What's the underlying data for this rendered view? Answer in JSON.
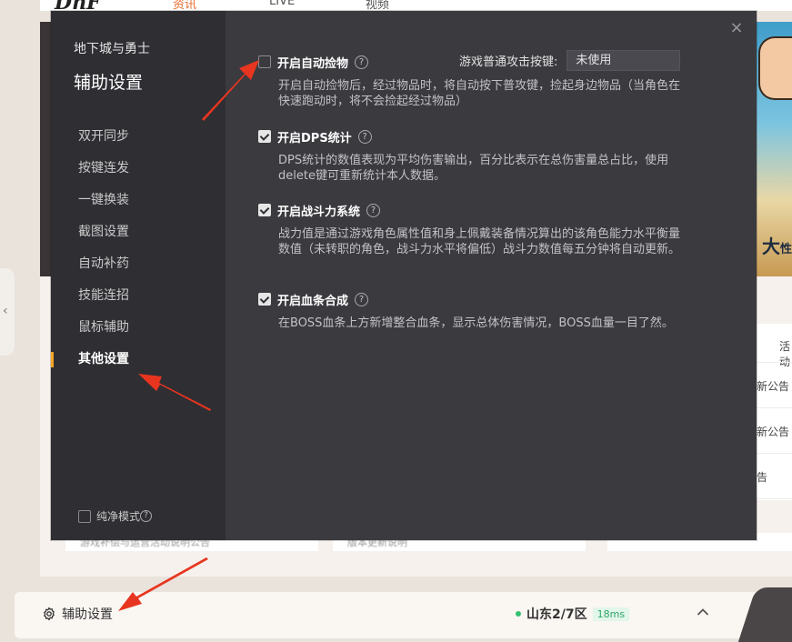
{
  "background": {
    "logo": "DnF",
    "nav": [
      "资讯",
      "LIVE",
      "视频"
    ],
    "side_tab_arrow": "‹",
    "banner_text": "大",
    "banner_subtext": "性",
    "panel_head": "活动",
    "panel_items": [
      "新公告",
      "新公告",
      "告"
    ],
    "card_texts": [
      "游戏补偿与运营活动说明公告",
      "版本更新说明"
    ]
  },
  "bottom_bar": {
    "settings_label": "辅助设置",
    "server_name": "山东2/7区",
    "ping": "18ms",
    "chevron": "⌃"
  },
  "dialog": {
    "game_name": "地下城与勇士",
    "title": "辅助设置",
    "close": "×",
    "menu": [
      {
        "label": "双开同步",
        "active": false
      },
      {
        "label": "按键连发",
        "active": false
      },
      {
        "label": "一键换装",
        "active": false
      },
      {
        "label": "截图设置",
        "active": false
      },
      {
        "label": "自动补药",
        "active": false
      },
      {
        "label": "技能连招",
        "active": false
      },
      {
        "label": "鼠标辅助",
        "active": false
      },
      {
        "label": "其他设置",
        "active": true
      }
    ],
    "pure_mode": {
      "label": "纯净模式",
      "checked": false
    },
    "attack_key": {
      "label": "游戏普通攻击按键:",
      "value": "未使用"
    },
    "options": [
      {
        "label": "开启自动捡物",
        "checked": false,
        "desc": "开启自动捡物后，经过物品时，将自动按下普攻键，捡起身边物品（当角色在快速跑动时，将不会捡起经过物品）"
      },
      {
        "label": "开启DPS统计",
        "checked": true,
        "desc": "DPS统计的数值表现为平均伤害输出，百分比表示在总伤害量总占比，使用delete键可重新统计本人数据。"
      },
      {
        "label": "开启战斗力系统",
        "checked": true,
        "desc": "战力值是通过游戏角色属性值和身上佩戴装备情况算出的该角色能力水平衡量数值（未转职的角色，战斗力水平将偏低）战斗力数值每五分钟将自动更新。"
      },
      {
        "label": "开启血条合成",
        "checked": true,
        "desc": "在BOSS血条上方新增整合血条，显示总体伤害情况，BOSS血量一目了然。"
      }
    ]
  },
  "colors": {
    "accent": "#f5a623",
    "annotation": "#e8351f",
    "dialog_bg": "#3b3a3f",
    "sidebar_bg": "#2f2e33"
  }
}
